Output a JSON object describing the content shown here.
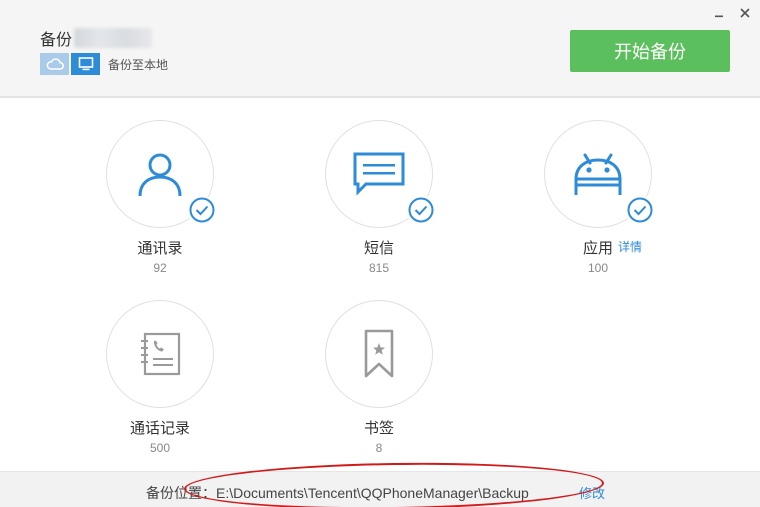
{
  "header": {
    "title": "备份",
    "mode_label": "备份至本地",
    "start_button": "开始备份"
  },
  "items": [
    {
      "label": "通讯录",
      "count": "92"
    },
    {
      "label": "短信",
      "count": "815"
    },
    {
      "label": "应用",
      "count": "100",
      "detail": "详情"
    },
    {
      "label": "通话记录",
      "count": "500"
    },
    {
      "label": "书签",
      "count": "8"
    }
  ],
  "footer": {
    "location_label": "备份位置：",
    "location_path": "E:\\Documents\\Tencent\\QQPhoneManager\\Backup",
    "modify": "修改"
  },
  "colors": {
    "accent_blue": "#2d8bd8",
    "start_green": "#5cbf5d",
    "annotation_red": "#d11a1a"
  }
}
